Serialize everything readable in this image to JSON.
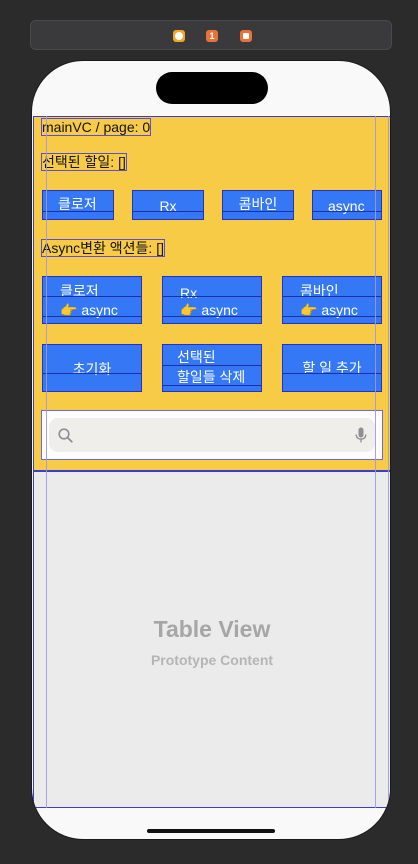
{
  "header": {
    "page_label": "mainVC / page: 0",
    "selected_label": "선택된 할일: []",
    "async_label": "Async변환 액션들: []"
  },
  "row1": [
    "클로저",
    "Rx",
    "콤바인",
    "async"
  ],
  "row2": [
    {
      "top": "클로저",
      "bottom": "👉 async"
    },
    {
      "top": "Rx",
      "bottom": "👉 async"
    },
    {
      "top": "콤바인",
      "bottom": "👉 async"
    }
  ],
  "row3": {
    "init": "초기화",
    "delete_top": "선택된",
    "delete_bottom": "할일들 삭제",
    "add": "할 일 추가"
  },
  "search": {
    "placeholder": ""
  },
  "table": {
    "title": "Table View",
    "subtitle": "Prototype Content"
  },
  "colors": {
    "header": "#f8cb47",
    "button": "#3478f6",
    "outline": "#3b3bd6"
  }
}
